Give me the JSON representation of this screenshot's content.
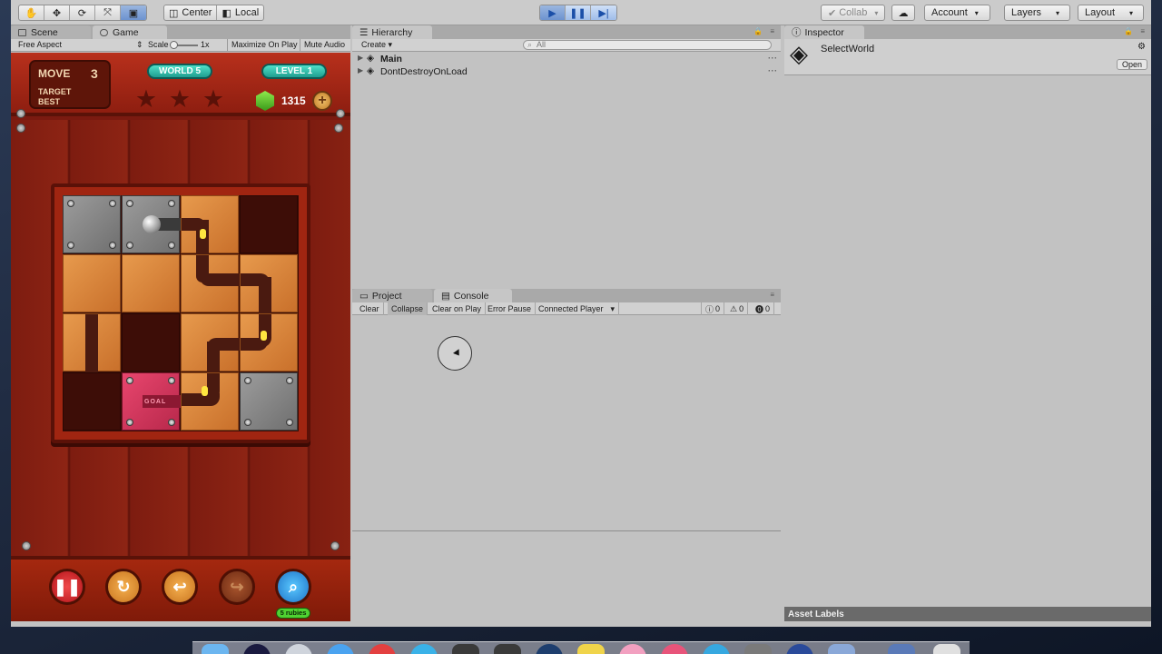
{
  "toolbar": {
    "pivot_label": "Center",
    "space_label": "Local",
    "collab_label": "Collab",
    "account_label": "Account",
    "layers_label": "Layers",
    "layout_label": "Layout"
  },
  "game_panel": {
    "tabs": [
      {
        "label": "Scene"
      },
      {
        "label": "Game"
      }
    ],
    "aspect": "Free Aspect",
    "scale_label": "Scale",
    "scale_value": "1x",
    "maximize_label": "Maximize On Play",
    "mute_label": "Mute Audio"
  },
  "game": {
    "move_label": "MOVE",
    "move_value": "3",
    "target_label": "TARGET",
    "best_label": "BEST",
    "world_label": "WORLD 5",
    "level_label": "LEVEL 1",
    "gems": "1315",
    "goal_label": "GOAL",
    "rubies_label": "5 rubies"
  },
  "hierarchy": {
    "tab_label": "Hierarchy",
    "create_label": "Create",
    "search_placeholder": "All",
    "scenes": [
      {
        "name": "Main"
      },
      {
        "name": "DontDestroyOnLoad"
      }
    ]
  },
  "console_panel": {
    "tabs": [
      {
        "label": "Project"
      },
      {
        "label": "Console"
      }
    ],
    "buttons": {
      "clear": "Clear",
      "collapse": "Collapse",
      "clear_on_play": "Clear on Play",
      "error_pause": "Error Pause",
      "connected_player": "Connected Player"
    },
    "counts": {
      "info": "0",
      "warning": "0",
      "error": "0"
    }
  },
  "inspector": {
    "tab_label": "Inspector",
    "object_name": "SelectWorld",
    "open_label": "Open",
    "asset_labels": "Asset Labels"
  },
  "colors": {
    "play_active": "#6d93cf",
    "game_bg": "#8e1e10",
    "accent_teal": "#1f9e90"
  }
}
